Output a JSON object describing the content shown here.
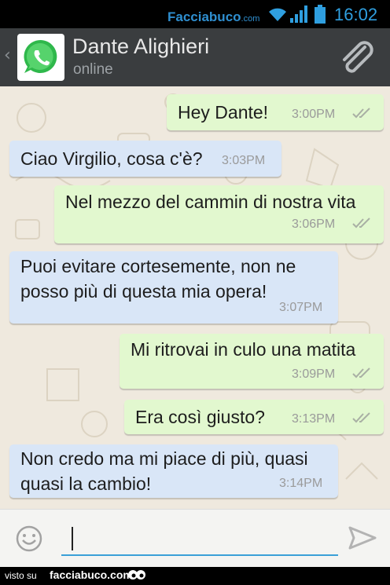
{
  "status_bar": {
    "brand": "Facciabuco",
    "brand_domain": ".com",
    "time": "16:02",
    "icons": [
      "wifi-icon",
      "signal-icon",
      "battery-icon"
    ],
    "color": "#2f9fe0"
  },
  "header": {
    "contact_name": "Dante Alighieri",
    "status": "online",
    "icons": [
      "back-icon",
      "whatsapp-logo-icon",
      "attach-paperclip-icon"
    ],
    "background": "#3a3d3f"
  },
  "messages": [
    {
      "direction": "out",
      "text": "Hey Dante!",
      "time": "3:00PM",
      "read": true
    },
    {
      "direction": "in",
      "text": "Ciao Virgilio, cosa c'è?",
      "time": "3:03PM"
    },
    {
      "direction": "out",
      "text": "Nel mezzo del cammin di nostra vita",
      "time": "3:06PM",
      "read": true
    },
    {
      "direction": "in",
      "lines": [
        "Puoi evitare cortesemente, non ne",
        "posso più di questa mia opera!"
      ],
      "time": "3:07PM"
    },
    {
      "direction": "out",
      "text": "Mi ritrovai in culo una matita",
      "time": "3:09PM",
      "read": true
    },
    {
      "direction": "out",
      "text": "Era così giusto?",
      "time": "3:13PM",
      "read": true
    },
    {
      "direction": "in",
      "lines": [
        "Non credo ma mi piace di più, quasi",
        "quasi la cambio!"
      ],
      "time": "3:14PM"
    }
  ],
  "colors": {
    "outgoing_bubble": "#e2f8cf",
    "incoming_bubble": "#d9e6f7",
    "chat_background": "#efe9de",
    "input_underline": "#3aa0d8"
  },
  "composer": {
    "value": "",
    "icons": [
      "emoji-icon",
      "send-icon"
    ]
  },
  "footer": {
    "prefix": "visto su",
    "site": "facciabuco.com"
  }
}
